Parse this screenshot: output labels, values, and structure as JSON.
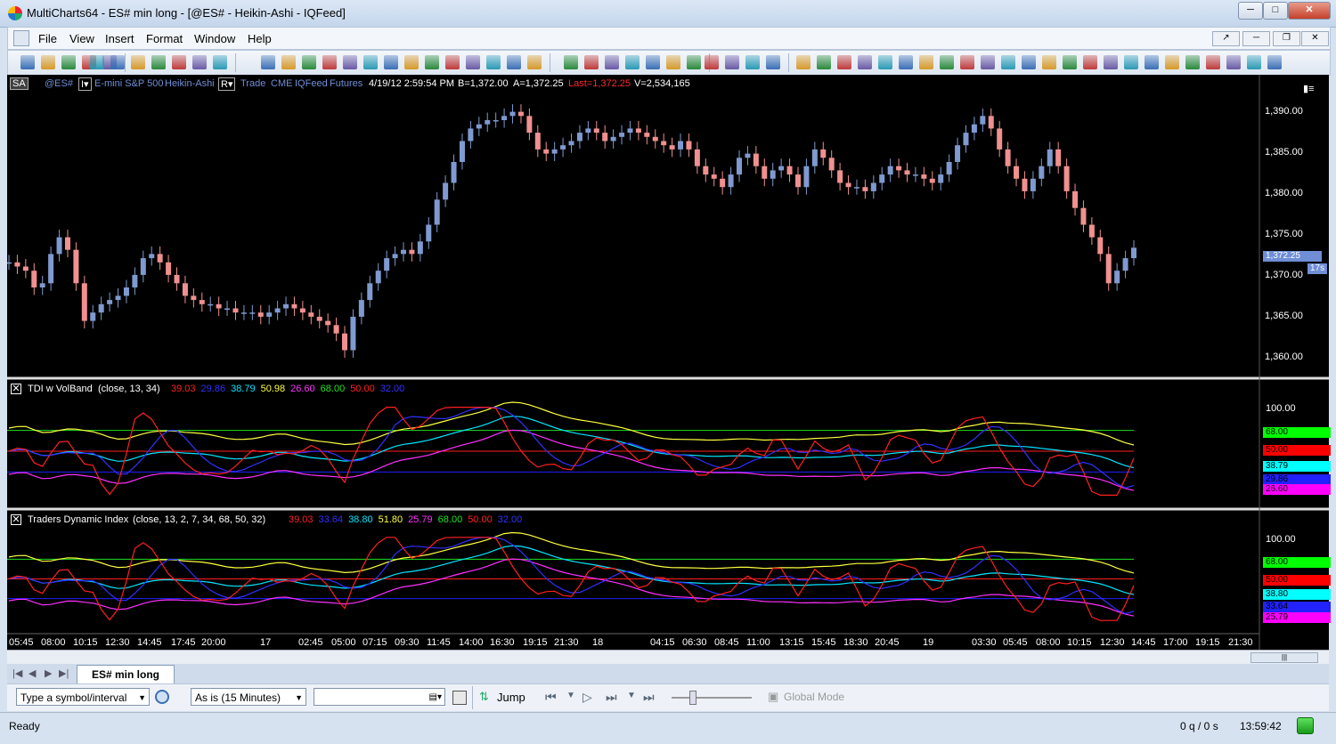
{
  "window": {
    "title": "MultiCharts64 - ES# min long - [@ES# - Heikin-Ashi - IQFeed]",
    "minimize": "─",
    "maximize": "□",
    "close": "✕"
  },
  "menu": [
    "File",
    "View",
    "Insert",
    "Format",
    "Window",
    "Help"
  ],
  "chart_header": {
    "data_source_badge": "SA",
    "symbol": "@ES#",
    "description": "E-mini S&P 500",
    "chart_type": "Heikin-Ashi",
    "mode": "Trade",
    "exchange": "CME",
    "feed": "IQFeed",
    "category": "Futures",
    "datetime": "4/19/12  2:59:54 PM",
    "bid": "B=1,372.00",
    "ask": "A=1,372.25",
    "last": "Last=1,372.25",
    "volume": "V=2,534,165",
    "colors": {
      "header_blue": "#6f8ed6",
      "last_red": "#ff2a2a",
      "white": "#ffffff"
    }
  },
  "price_axis": {
    "ticks": [
      "1,390.00",
      "1,385.00",
      "1,380.00",
      "1,375.00",
      "1,370.00",
      "1,365.00",
      "1,360.00"
    ],
    "current_price": "1,372.25",
    "bar_timer": "17s"
  },
  "indicator1": {
    "title": "TDI w VolBand",
    "params": "(close,  13,  34)",
    "values": [
      {
        "v": "39.03",
        "color": "#ff2020"
      },
      {
        "v": "29.86",
        "color": "#3030ff"
      },
      {
        "v": "38.79",
        "color": "#00e5ff"
      },
      {
        "v": "50.98",
        "color": "#ffff40"
      },
      {
        "v": "26.60",
        "color": "#ff30ff"
      },
      {
        "v": "68.00",
        "color": "#20e020"
      },
      {
        "v": "50.00",
        "color": "#ff2020"
      },
      {
        "v": "32.00",
        "color": "#3030ff"
      }
    ],
    "axis_top": "100.00",
    "labels": [
      {
        "v": "68.00",
        "bg": "#00ff00",
        "fg": "#000"
      },
      {
        "v": "50.00",
        "bg": "#ff0000",
        "fg": "#000"
      },
      {
        "v": "38.79",
        "bg": "#00ffff",
        "fg": "#000"
      },
      {
        "v": "29.86",
        "bg": "#2222ff",
        "fg": "#000"
      },
      {
        "v": "26.60",
        "bg": "#ff00ff",
        "fg": "#000"
      }
    ]
  },
  "indicator2": {
    "title": "Traders Dynamic Index",
    "params": "(close,  13,  2,  7,  34,  68,  50,  32)",
    "values": [
      {
        "v": "39.03",
        "color": "#ff2020"
      },
      {
        "v": "33.64",
        "color": "#3030ff"
      },
      {
        "v": "38.80",
        "color": "#00e5ff"
      },
      {
        "v": "51.80",
        "color": "#ffff40"
      },
      {
        "v": "25.79",
        "color": "#ff30ff"
      },
      {
        "v": "68.00",
        "color": "#20e020"
      },
      {
        "v": "50.00",
        "color": "#ff2020"
      },
      {
        "v": "32.00",
        "color": "#3030ff"
      }
    ],
    "axis_top": "100.00",
    "labels": [
      {
        "v": "68.00",
        "bg": "#00ff00",
        "fg": "#000"
      },
      {
        "v": "50.00",
        "bg": "#ff0000",
        "fg": "#000"
      },
      {
        "v": "38.80",
        "bg": "#00ffff",
        "fg": "#000"
      },
      {
        "v": "33.64",
        "bg": "#2222ff",
        "fg": "#000"
      },
      {
        "v": "25.79",
        "bg": "#ff00ff",
        "fg": "#000"
      }
    ]
  },
  "time_axis": [
    "05:45",
    "08:00",
    "10:15",
    "12:30",
    "14:45",
    "17:45",
    "20:00",
    "17",
    "02:45",
    "05:00",
    "07:15",
    "09:30",
    "11:45",
    "14:00",
    "16:30",
    "19:15",
    "21:30",
    "18",
    "04:15",
    "06:30",
    "08:45",
    "11:00",
    "13:15",
    "15:45",
    "18:30",
    "20:45",
    "19",
    "03:30",
    "05:45",
    "08:00",
    "10:15",
    "12:30",
    "14:45",
    "17:00",
    "19:15",
    "21:30"
  ],
  "tabs": {
    "active": "ES# min long"
  },
  "navigation": {
    "symbol_placeholder": "Type a symbol/interval",
    "resolution": "As is (15 Minutes)",
    "date_field": "",
    "jump": "Jump",
    "global_mode": "Global Mode"
  },
  "status": {
    "ready": "Ready",
    "queue": "0 q / 0 s",
    "clock": "13:59:42"
  },
  "chart_data": {
    "type": "line",
    "title": "",
    "price_series_close": [
      1370.5,
      1370.0,
      1369.5,
      1367.5,
      1368.0,
      1371.5,
      1373.5,
      1372.0,
      1368.0,
      1363.5,
      1364.5,
      1365.5,
      1366.0,
      1366.5,
      1367.5,
      1369.0,
      1371.0,
      1371.5,
      1370.5,
      1369.0,
      1368.0,
      1366.5,
      1366.0,
      1365.5,
      1365.5,
      1365.0,
      1365.0,
      1364.5,
      1364.5,
      1364.5,
      1364.0,
      1364.5,
      1365.0,
      1365.5,
      1365.0,
      1364.5,
      1364.0,
      1363.5,
      1363.0,
      1362.0,
      1360.0,
      1364.0,
      1366.0,
      1368.0,
      1369.5,
      1371.0,
      1371.5,
      1372.0,
      1371.5,
      1373.0,
      1375.0,
      1378.0,
      1380.0,
      1382.5,
      1385.0,
      1386.5,
      1387.0,
      1387.5,
      1387.5,
      1388.0,
      1388.5,
      1388.0,
      1386.0,
      1384.0,
      1383.5,
      1384.0,
      1384.5,
      1385.0,
      1386.0,
      1386.5,
      1386.0,
      1385.0,
      1385.5,
      1386.0,
      1386.5,
      1386.0,
      1385.5,
      1385.0,
      1384.5,
      1384.0,
      1385.0,
      1384.0,
      1382.0,
      1381.0,
      1380.5,
      1379.5,
      1381.0,
      1383.0,
      1383.5,
      1382.0,
      1380.5,
      1381.5,
      1382.0,
      1381.0,
      1379.5,
      1382.0,
      1384.0,
      1383.0,
      1381.5,
      1380.0,
      1379.5,
      1379.5,
      1379.0,
      1380.0,
      1381.0,
      1382.0,
      1381.5,
      1381.0,
      1381.0,
      1380.5,
      1380.0,
      1381.0,
      1382.5,
      1384.5,
      1386.0,
      1387.0,
      1388.0,
      1386.5,
      1384.0,
      1382.0,
      1380.5,
      1379.0,
      1380.5,
      1382.0,
      1384.0,
      1382.0,
      1379.0,
      1377.0,
      1375.0,
      1373.5,
      1371.5,
      1368.0,
      1369.5,
      1371.0,
      1372.25
    ],
    "price_ylim": [
      1357.5,
      1392.5
    ],
    "tdi_levels": [
      68,
      50,
      32
    ],
    "tdi_ylim": [
      0,
      100
    ]
  }
}
